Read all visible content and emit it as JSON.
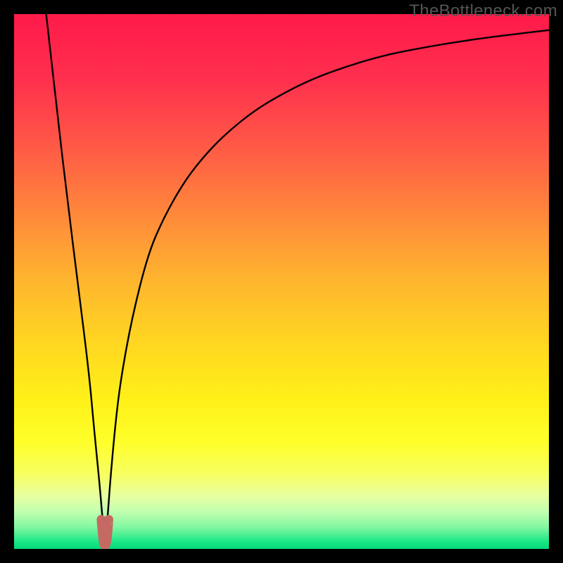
{
  "watermark": "TheBottleneck.com",
  "chart_data": {
    "type": "line",
    "title": "",
    "xlabel": "",
    "ylabel": "",
    "xlim": [
      0,
      100
    ],
    "ylim": [
      0,
      100
    ],
    "series": [
      {
        "name": "bottleneck-curve",
        "x": [
          6,
          8,
          10,
          12,
          14,
          15,
          16,
          16.5,
          17,
          17.5,
          18,
          19,
          20,
          22,
          25,
          28,
          32,
          36,
          40,
          45,
          50,
          56,
          63,
          70,
          78,
          86,
          94,
          100
        ],
        "values": [
          100,
          82,
          65,
          49,
          33,
          22,
          12,
          6,
          1,
          6,
          13,
          24,
          32,
          43,
          55,
          62,
          69,
          74,
          78,
          82,
          85,
          88,
          90.5,
          92.5,
          94,
          95.3,
          96.3,
          97
        ]
      },
      {
        "name": "optimal-marker",
        "x": [
          16.3,
          16.5,
          16.7,
          17.0,
          17.3,
          17.5,
          17.7
        ],
        "values": [
          5.5,
          3.0,
          1.2,
          0.5,
          1.2,
          3.0,
          5.5
        ]
      }
    ],
    "background_gradient": {
      "type": "vertical",
      "stops": [
        {
          "pos": 0.0,
          "color": "#ff1a4a"
        },
        {
          "pos": 0.12,
          "color": "#ff2f4e"
        },
        {
          "pos": 0.25,
          "color": "#ff5a46"
        },
        {
          "pos": 0.38,
          "color": "#ff8a3a"
        },
        {
          "pos": 0.5,
          "color": "#ffb62e"
        },
        {
          "pos": 0.62,
          "color": "#ffd820"
        },
        {
          "pos": 0.72,
          "color": "#fff018"
        },
        {
          "pos": 0.8,
          "color": "#ffff2a"
        },
        {
          "pos": 0.86,
          "color": "#f7ff60"
        },
        {
          "pos": 0.9,
          "color": "#e8ffa0"
        },
        {
          "pos": 0.93,
          "color": "#c2ffb0"
        },
        {
          "pos": 0.96,
          "color": "#80f7a0"
        },
        {
          "pos": 0.985,
          "color": "#20e88a"
        },
        {
          "pos": 1.0,
          "color": "#00d878"
        }
      ]
    },
    "curve_color": "#000000",
    "marker_color": "#c56a62"
  }
}
